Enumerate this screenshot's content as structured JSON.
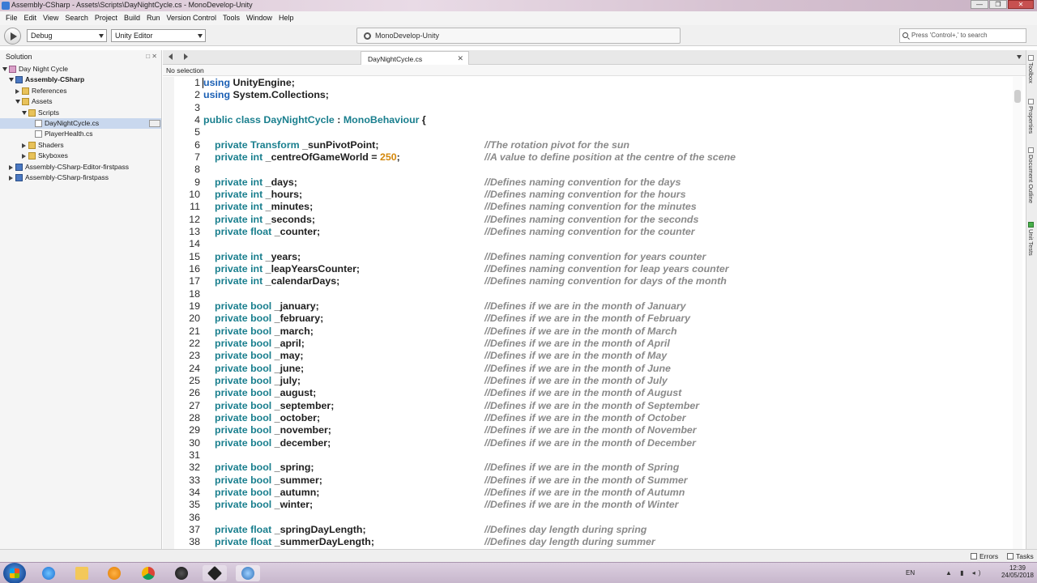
{
  "window": {
    "title": "Assembly-CSharp - Assets\\Scripts\\DayNightCycle.cs - MonoDevelop-Unity",
    "buttons": [
      "—",
      "❐",
      "✕"
    ]
  },
  "menu": [
    "File",
    "Edit",
    "View",
    "Search",
    "Project",
    "Build",
    "Run",
    "Version Control",
    "Tools",
    "Window",
    "Help"
  ],
  "toolbar": {
    "config": "Debug",
    "target": "Unity Editor",
    "status": "MonoDevelop-Unity",
    "search_placeholder": "Press 'Control+,' to search"
  },
  "solution": {
    "title": "Solution",
    "header_buttons": "□ ✕",
    "items": [
      {
        "label": "Day Night Cycle",
        "indent": 0,
        "toggle": "open",
        "icon": "sol"
      },
      {
        "label": "Assembly-CSharp",
        "indent": 1,
        "toggle": "open",
        "icon": "proj",
        "bold": true
      },
      {
        "label": "References",
        "indent": 2,
        "toggle": "closed",
        "icon": "folder"
      },
      {
        "label": "Assets",
        "indent": 2,
        "toggle": "open",
        "icon": "folder"
      },
      {
        "label": "Scripts",
        "indent": 3,
        "toggle": "open",
        "icon": "folder"
      },
      {
        "label": "DayNightCycle.cs",
        "indent": 4,
        "toggle": "",
        "icon": "file",
        "selected": true
      },
      {
        "label": "PlayerHealth.cs",
        "indent": 4,
        "toggle": "",
        "icon": "file"
      },
      {
        "label": "Shaders",
        "indent": 3,
        "toggle": "closed",
        "icon": "folder"
      },
      {
        "label": "Skyboxes",
        "indent": 3,
        "toggle": "closed",
        "icon": "folder"
      },
      {
        "label": "Assembly-CSharp-Editor-firstpass",
        "indent": 1,
        "toggle": "closed",
        "icon": "proj"
      },
      {
        "label": "Assembly-CSharp-firstpass",
        "indent": 1,
        "toggle": "closed",
        "icon": "proj"
      }
    ]
  },
  "editor": {
    "tab": "DayNightCycle.cs",
    "tab_close": "✕",
    "selection": "No selection",
    "lines": [
      {
        "n": "1",
        "indent": 0,
        "tokens": [
          [
            "k-using",
            "using"
          ],
          [
            "k-id",
            " UnityEngine;"
          ]
        ],
        "comment": ""
      },
      {
        "n": "2",
        "indent": 0,
        "tokens": [
          [
            "k-using",
            "using"
          ],
          [
            "k-id",
            " System.Collections;"
          ]
        ],
        "comment": ""
      },
      {
        "n": "3",
        "indent": 0,
        "tokens": [],
        "comment": ""
      },
      {
        "n": "4",
        "indent": 0,
        "tokens": [
          [
            "k-kw",
            "public class"
          ],
          [
            "k-class",
            " DayNightCycle"
          ],
          [
            "k-id",
            " : "
          ],
          [
            "k-class",
            "MonoBehaviour"
          ],
          [
            "k-id",
            " {"
          ]
        ],
        "comment": ""
      },
      {
        "n": "5",
        "indent": 0,
        "tokens": [],
        "comment": ""
      },
      {
        "n": "6",
        "indent": 1,
        "tokens": [
          [
            "k-kw",
            "private"
          ],
          [
            "k-type",
            " Transform"
          ],
          [
            "k-id",
            " _sunPivotPoint;"
          ]
        ],
        "comment": "//The rotation pivot for the sun"
      },
      {
        "n": "7",
        "indent": 1,
        "tokens": [
          [
            "k-kw",
            "private"
          ],
          [
            "k-type",
            " int"
          ],
          [
            "k-id",
            " _centreOfGameWorld = "
          ],
          [
            "k-num",
            "250"
          ],
          [
            "k-id",
            ";"
          ]
        ],
        "comment": "//A value to define position at the centre of the scene"
      },
      {
        "n": "8",
        "indent": 0,
        "tokens": [],
        "comment": ""
      },
      {
        "n": "9",
        "indent": 1,
        "tokens": [
          [
            "k-kw",
            "private"
          ],
          [
            "k-type",
            " int"
          ],
          [
            "k-id",
            " _days;"
          ]
        ],
        "comment": "//Defines naming convention for the days"
      },
      {
        "n": "10",
        "indent": 1,
        "tokens": [
          [
            "k-kw",
            "private"
          ],
          [
            "k-type",
            " int"
          ],
          [
            "k-id",
            " _hours;"
          ]
        ],
        "comment": "//Defines naming convention for the hours"
      },
      {
        "n": "11",
        "indent": 1,
        "tokens": [
          [
            "k-kw",
            "private"
          ],
          [
            "k-type",
            " int"
          ],
          [
            "k-id",
            " _minutes;"
          ]
        ],
        "comment": "//Defines naming convention for the minutes"
      },
      {
        "n": "12",
        "indent": 1,
        "tokens": [
          [
            "k-kw",
            "private"
          ],
          [
            "k-type",
            " int"
          ],
          [
            "k-id",
            " _seconds;"
          ]
        ],
        "comment": "//Defines naming convention for the seconds"
      },
      {
        "n": "13",
        "indent": 1,
        "tokens": [
          [
            "k-kw",
            "private"
          ],
          [
            "k-type",
            " float"
          ],
          [
            "k-id",
            " _counter;"
          ]
        ],
        "comment": "//Defines naming convention for the counter"
      },
      {
        "n": "14",
        "indent": 0,
        "tokens": [],
        "comment": ""
      },
      {
        "n": "15",
        "indent": 1,
        "tokens": [
          [
            "k-kw",
            "private"
          ],
          [
            "k-type",
            " int"
          ],
          [
            "k-id",
            " _years;"
          ]
        ],
        "comment": "//Defines naming convention for years counter"
      },
      {
        "n": "16",
        "indent": 1,
        "tokens": [
          [
            "k-kw",
            "private"
          ],
          [
            "k-type",
            " int"
          ],
          [
            "k-id",
            " _leapYearsCounter;"
          ]
        ],
        "comment": "//Defines naming convention for leap years counter"
      },
      {
        "n": "17",
        "indent": 1,
        "tokens": [
          [
            "k-kw",
            "private"
          ],
          [
            "k-type",
            " int"
          ],
          [
            "k-id",
            " _calendarDays;"
          ]
        ],
        "comment": "//Defines naming convention for days of the month"
      },
      {
        "n": "18",
        "indent": 0,
        "tokens": [],
        "comment": ""
      },
      {
        "n": "19",
        "indent": 1,
        "tokens": [
          [
            "k-kw",
            "private"
          ],
          [
            "k-type",
            " bool"
          ],
          [
            "k-id",
            " _january;"
          ]
        ],
        "comment": "//Defines if we are in the month of January"
      },
      {
        "n": "20",
        "indent": 1,
        "tokens": [
          [
            "k-kw",
            "private"
          ],
          [
            "k-type",
            " bool"
          ],
          [
            "k-id",
            " _february;"
          ]
        ],
        "comment": "//Defines if we are in the month of February"
      },
      {
        "n": "21",
        "indent": 1,
        "tokens": [
          [
            "k-kw",
            "private"
          ],
          [
            "k-type",
            " bool"
          ],
          [
            "k-id",
            " _march;"
          ]
        ],
        "comment": "//Defines if we are in the month of March"
      },
      {
        "n": "22",
        "indent": 1,
        "tokens": [
          [
            "k-kw",
            "private"
          ],
          [
            "k-type",
            " bool"
          ],
          [
            "k-id",
            " _april;"
          ]
        ],
        "comment": "//Defines if we are in the month of April"
      },
      {
        "n": "23",
        "indent": 1,
        "tokens": [
          [
            "k-kw",
            "private"
          ],
          [
            "k-type",
            " bool"
          ],
          [
            "k-id",
            " _may;"
          ]
        ],
        "comment": "//Defines if we are in the month of May"
      },
      {
        "n": "24",
        "indent": 1,
        "tokens": [
          [
            "k-kw",
            "private"
          ],
          [
            "k-type",
            " bool"
          ],
          [
            "k-id",
            " _june;"
          ]
        ],
        "comment": "//Defines if we are in the month of June"
      },
      {
        "n": "25",
        "indent": 1,
        "tokens": [
          [
            "k-kw",
            "private"
          ],
          [
            "k-type",
            " bool"
          ],
          [
            "k-id",
            " _july;"
          ]
        ],
        "comment": "//Defines if we are in the month of July"
      },
      {
        "n": "26",
        "indent": 1,
        "tokens": [
          [
            "k-kw",
            "private"
          ],
          [
            "k-type",
            " bool"
          ],
          [
            "k-id",
            " _august;"
          ]
        ],
        "comment": "//Defines if we are in the month of August"
      },
      {
        "n": "27",
        "indent": 1,
        "tokens": [
          [
            "k-kw",
            "private"
          ],
          [
            "k-type",
            " bool"
          ],
          [
            "k-id",
            " _september;"
          ]
        ],
        "comment": "//Defines if we are in the month of September"
      },
      {
        "n": "28",
        "indent": 1,
        "tokens": [
          [
            "k-kw",
            "private"
          ],
          [
            "k-type",
            " bool"
          ],
          [
            "k-id",
            " _october;"
          ]
        ],
        "comment": "//Defines if we are in the month of October"
      },
      {
        "n": "29",
        "indent": 1,
        "tokens": [
          [
            "k-kw",
            "private"
          ],
          [
            "k-type",
            " bool"
          ],
          [
            "k-id",
            " _november;"
          ]
        ],
        "comment": "//Defines if we are in the month of November"
      },
      {
        "n": "30",
        "indent": 1,
        "tokens": [
          [
            "k-kw",
            "private"
          ],
          [
            "k-type",
            " bool"
          ],
          [
            "k-id",
            " _december;"
          ]
        ],
        "comment": "//Defines if we are in the month of December"
      },
      {
        "n": "31",
        "indent": 0,
        "tokens": [],
        "comment": ""
      },
      {
        "n": "32",
        "indent": 1,
        "tokens": [
          [
            "k-kw",
            "private"
          ],
          [
            "k-type",
            " bool"
          ],
          [
            "k-id",
            " _spring;"
          ]
        ],
        "comment": "//Defines if we are in the month of Spring"
      },
      {
        "n": "33",
        "indent": 1,
        "tokens": [
          [
            "k-kw",
            "private"
          ],
          [
            "k-type",
            " bool"
          ],
          [
            "k-id",
            " _summer;"
          ]
        ],
        "comment": "//Defines if we are in the month of Summer"
      },
      {
        "n": "34",
        "indent": 1,
        "tokens": [
          [
            "k-kw",
            "private"
          ],
          [
            "k-type",
            " bool"
          ],
          [
            "k-id",
            " _autumn;"
          ]
        ],
        "comment": "//Defines if we are in the month of Autumn"
      },
      {
        "n": "35",
        "indent": 1,
        "tokens": [
          [
            "k-kw",
            "private"
          ],
          [
            "k-type",
            " bool"
          ],
          [
            "k-id",
            " _winter;"
          ]
        ],
        "comment": "//Defines if we are in the month of Winter"
      },
      {
        "n": "36",
        "indent": 0,
        "tokens": [],
        "comment": ""
      },
      {
        "n": "37",
        "indent": 1,
        "tokens": [
          [
            "k-kw",
            "private"
          ],
          [
            "k-type",
            " float"
          ],
          [
            "k-id",
            " _springDayLength;"
          ]
        ],
        "comment": "//Defines day length during spring"
      },
      {
        "n": "38",
        "indent": 1,
        "tokens": [
          [
            "k-kw",
            "private"
          ],
          [
            "k-type",
            " float"
          ],
          [
            "k-id",
            " _summerDayLength;"
          ]
        ],
        "comment": "//Defines day length during summer"
      }
    ]
  },
  "right_dock": [
    "Toolbox",
    "Properties",
    "Document Outline",
    "Unit Tests"
  ],
  "statusbar": {
    "errors": "Errors",
    "tasks": "Tasks"
  },
  "taskbar": {
    "apps": [
      "internet-explorer-icon",
      "file-explorer-icon",
      "media-player-icon",
      "chrome-icon",
      "obs-icon",
      "unity-icon",
      "monodevelop-icon"
    ],
    "language": "EN",
    "time": "12:39",
    "date": "24/05/2018"
  },
  "colors": {
    "keyword": "#1a7f8e",
    "using": "#1a5fb4",
    "number": "#d4880c",
    "comment": "#8a8a8a",
    "selection": "#c9d8ee"
  }
}
